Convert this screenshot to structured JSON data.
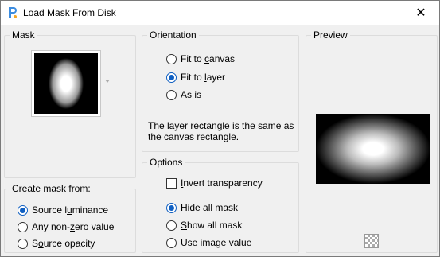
{
  "window": {
    "title": "Load Mask From Disk",
    "close_glyph": "✕"
  },
  "mask": {
    "legend": "Mask"
  },
  "orientation": {
    "legend": "Orientation",
    "options": [
      {
        "pre": "Fit to ",
        "key": "c",
        "post": "anvas",
        "selected": false
      },
      {
        "pre": "Fit to ",
        "key": "l",
        "post": "ayer",
        "selected": true
      },
      {
        "pre": "",
        "key": "A",
        "post": "s is",
        "selected": false
      }
    ],
    "info_line1": "The layer rectangle is the same as",
    "info_line2": "the canvas rectangle."
  },
  "preview": {
    "legend": "Preview"
  },
  "create_mask": {
    "legend": "Create mask from:",
    "options": [
      {
        "pre": "Source l",
        "key": "u",
        "post": "minance",
        "selected": true
      },
      {
        "pre": "Any non-",
        "key": "z",
        "post": "ero value",
        "selected": false
      },
      {
        "pre": "S",
        "key": "o",
        "post": "urce opacity",
        "selected": false
      }
    ]
  },
  "options": {
    "legend": "Options",
    "invert": {
      "pre": "",
      "key": "I",
      "post": "nvert transparency",
      "checked": false
    },
    "hide": [
      {
        "pre": "",
        "key": "H",
        "post": "ide all mask",
        "selected": true
      },
      {
        "pre": "",
        "key": "S",
        "post": "how all mask",
        "selected": false
      },
      {
        "pre": "Use image ",
        "key": "v",
        "post": "alue",
        "selected": false
      }
    ]
  },
  "colors": {
    "accent": "#0f5fc2",
    "background": "#f0f0f0"
  }
}
